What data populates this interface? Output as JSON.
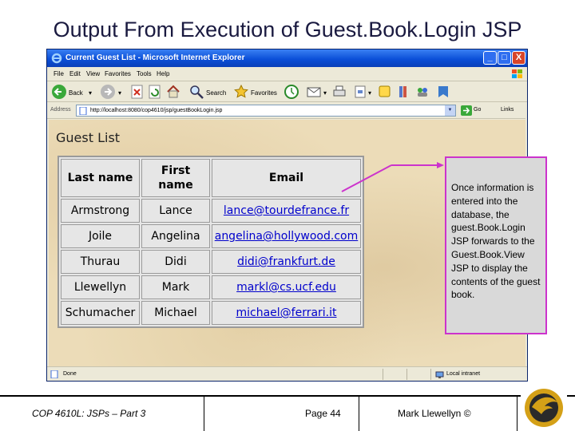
{
  "slide": {
    "title": "Output From Execution of Guest.Book.Login JSP"
  },
  "browser": {
    "window_title": "Current Guest List - Microsoft Internet Explorer",
    "window_buttons": [
      "_",
      "□",
      "X"
    ],
    "menu": [
      "File",
      "Edit",
      "View",
      "Favorites",
      "Tools",
      "Help"
    ],
    "toolbar": {
      "back_label": "Back",
      "search_label": "Search",
      "favorites_label": "Favorites"
    },
    "address": {
      "label": "Address",
      "url": "http://localhost:8080/cop4610/jsp/guestBookLogin.jsp",
      "go_label": "Go",
      "links_label": "Links"
    },
    "status": {
      "text": "Done",
      "zone": "Local intranet"
    }
  },
  "page": {
    "heading": "Guest List",
    "table": {
      "headers": [
        "Last name",
        "First name",
        "Email"
      ],
      "rows": [
        [
          "Armstrong",
          "Lance",
          "lance@tourdefrance.fr"
        ],
        [
          "Joile",
          "Angelina",
          "angelina@hollywood.com"
        ],
        [
          "Thurau",
          "Didi",
          "didi@frankfurt.de"
        ],
        [
          "Llewellyn",
          "Mark",
          "markl@cs.ucf.edu"
        ],
        [
          "Schumacher",
          "Michael",
          "michael@ferrari.it"
        ]
      ]
    }
  },
  "callout": {
    "text": "Once information is entered into the database, the guest.Book.Login JSP forwards to the Guest.Book.View JSP to display the contents of the guest book."
  },
  "footer": {
    "course": "COP 4610L: JSPs – Part 3",
    "page": "Page 44",
    "author": "Mark Llewellyn ©"
  },
  "colors": {
    "titlebar": "#0b4fd8",
    "callout_border": "#cc33cc",
    "callout_fill": "#d9d9d9",
    "link": "#0000cc"
  }
}
